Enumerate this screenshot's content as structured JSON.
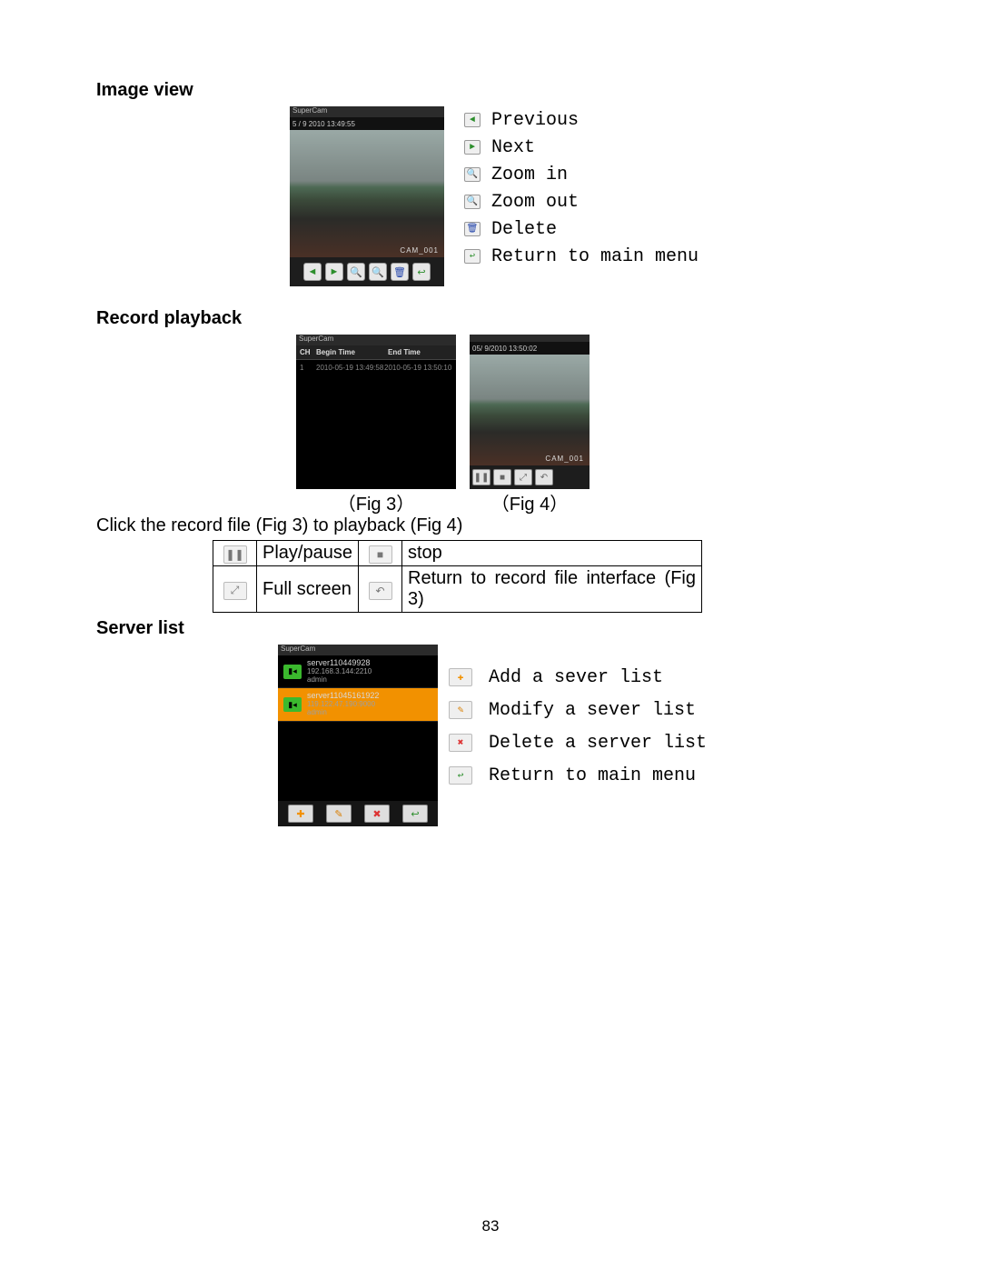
{
  "page_number": "83",
  "sections": {
    "image_view": "Image view",
    "record_playback": "Record playback",
    "server_list": "Server list"
  },
  "imgview": {
    "app_name": "SuperCam",
    "timestamp": "5 / 9 2010 13:49:55",
    "cam_label": "CAM_001",
    "legend": {
      "previous": "Previous",
      "next": "Next",
      "zoom_in": "Zoom in",
      "zoom_out": "Zoom out",
      "delete": "Delete",
      "return": "Return to main menu"
    }
  },
  "record": {
    "app_name": "SuperCam",
    "headers": {
      "ch": "CH",
      "begin": "Begin Time",
      "end": "End Time"
    },
    "row": {
      "ch": "1",
      "begin": "2010-05-19 13:49:58",
      "end": "2010-05-19 13:50:10"
    },
    "fig3": "（Fig 3）",
    "fig4": "（Fig 4）",
    "play_ts": "05/ 9/2010 13:50:02",
    "play_cam": "CAM_001",
    "click_text": "Click the record file (Fig 3) to playback (Fig 4)"
  },
  "playback_table": {
    "play_pause": "Play/pause",
    "stop": "stop",
    "full_screen": "Full screen",
    "return": "Return to record file interface (Fig 3)"
  },
  "server": {
    "app_name": "SuperCam",
    "items": [
      {
        "name": "server110449928",
        "ip": "192.168.3.144:2210",
        "user": "admin"
      },
      {
        "name": "server11045161922",
        "ip": "119.122.47.190:9000",
        "user": "admin"
      }
    ],
    "legend": {
      "add": "Add a sever list",
      "modify": "Modify a sever list",
      "delete": "Delete a server list",
      "return": "Return to main menu"
    }
  }
}
